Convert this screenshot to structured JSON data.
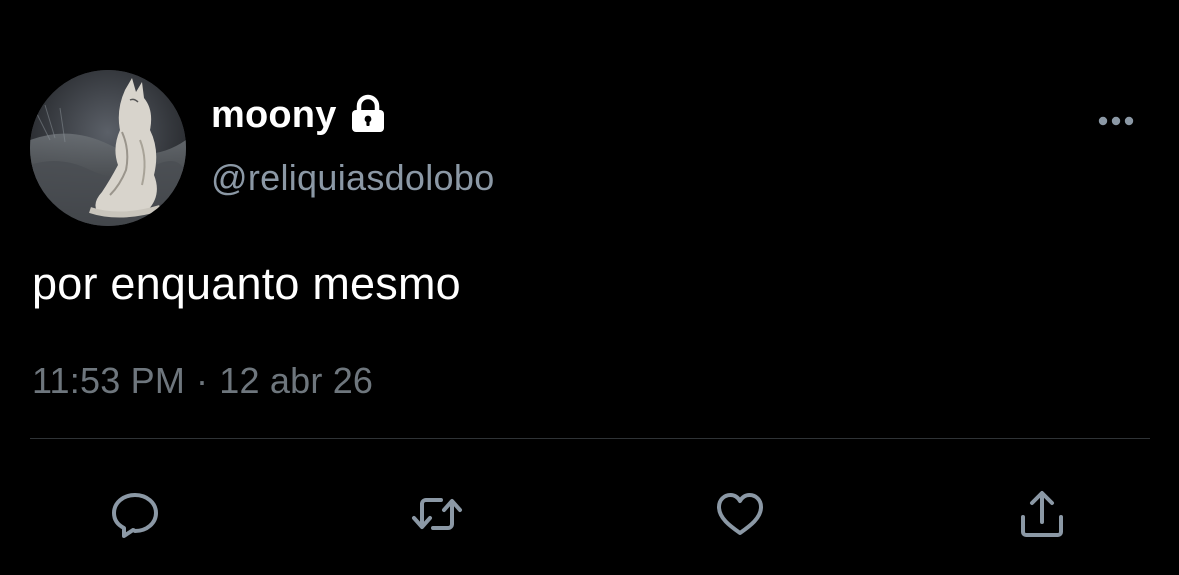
{
  "tweet": {
    "author": {
      "display_name": "moony",
      "handle": "@reliquiasdolobo",
      "protected_icon": "lock-icon",
      "avatar": "wolf-avatar"
    },
    "text": "por enquanto mesmo",
    "time": "11:53 PM",
    "separator": "·",
    "date": "12 abr 26"
  },
  "actions": [
    {
      "name": "reply",
      "icon": "speech-bubble-icon"
    },
    {
      "name": "retweet",
      "icon": "retweet-arrows-icon"
    },
    {
      "name": "like",
      "icon": "heart-icon"
    },
    {
      "name": "share",
      "icon": "share-upload-icon"
    }
  ],
  "menu": {
    "icon": "more-horizontal-icon"
  },
  "colors": {
    "background": "#000000",
    "primary_text": "#ffffff",
    "secondary_text": "#8b98a5",
    "meta_text": "#6e767d",
    "divider": "#2f3336",
    "icon": "#8b98a5"
  }
}
